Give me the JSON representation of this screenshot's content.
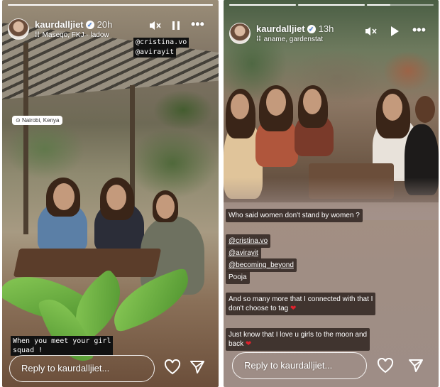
{
  "left_story": {
    "username": "kaurdalljiet",
    "verified_icon": "verified-check-icon",
    "time": "20h",
    "music_text": "Maseqo, FKJ · ladow",
    "mentions": [
      "@cristina.vo",
      "@avirayit"
    ],
    "location": "Nairobi, Kenya",
    "caption_lines": [
      "When you meet your girl",
      "squad !"
    ],
    "reply_placeholder": "Reply to kaurdalljiet...",
    "progress": 1.0
  },
  "right_story": {
    "username": "kaurdalljiet",
    "verified_icon": "verified-check-icon",
    "time": "13h",
    "music_text": "aname, gardenstat",
    "text_blocks": {
      "question": "Who said women don't stand by women ?",
      "mentions": [
        "@cristina.vo",
        "@avirayit",
        "@becoming_beyond"
      ],
      "name": "Pooja",
      "connected_lines": [
        "And so many more that I connected with that I",
        "don't choose to tag"
      ],
      "love_lines": [
        "Just know that I love u girls to the moon and",
        "back"
      ]
    },
    "reply_placeholder": "Reply to kaurdalljiet...",
    "progress_segments": [
      1.0,
      1.0,
      0.35
    ]
  },
  "icons": {
    "mute": "muted-speaker-icon",
    "pause": "pause-icon",
    "play": "play-icon",
    "more": "more-dots-icon",
    "heart": "heart-icon",
    "share": "send-icon",
    "location_pin": "location-pin-icon",
    "music": "music-bars-icon"
  },
  "colors": {
    "heart_emoji": "#e0222d",
    "verified": "#3c7be0"
  }
}
